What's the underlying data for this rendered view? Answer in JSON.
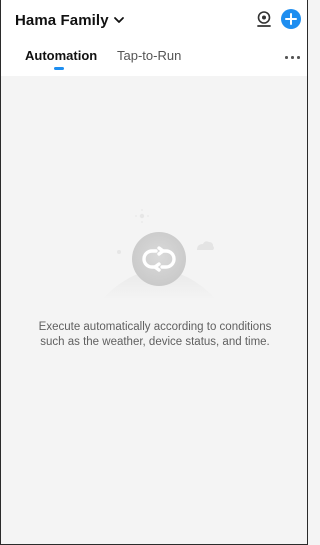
{
  "header": {
    "home_name": "Hama Family",
    "icons": [
      "chevron-down-icon",
      "camera-icon",
      "plus-icon",
      "more-icon"
    ],
    "accent_color": "#1e8ef0"
  },
  "tabs": [
    {
      "label": "Automation",
      "active": true
    },
    {
      "label": "Tap-to-Run",
      "active": false
    }
  ],
  "empty_state": {
    "icon": "automation-loop-icon",
    "message_line1": "Execute automatically according to conditions",
    "message_line2": "such as the weather, device status, and time."
  }
}
